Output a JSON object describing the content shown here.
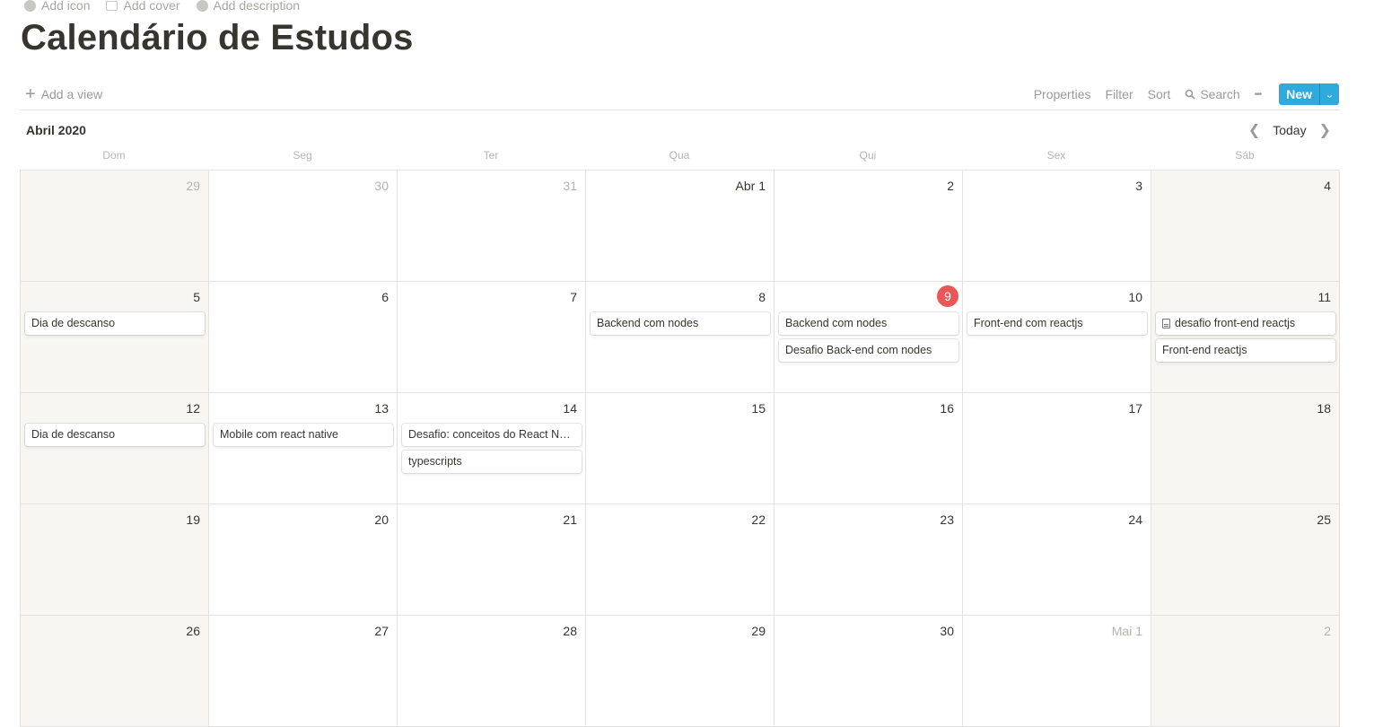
{
  "page_meta": {
    "add_icon": "Add icon",
    "add_cover": "Add cover",
    "add_description": "Add description"
  },
  "title": "Calendário de Estudos",
  "toolbar": {
    "add_view": "Add a view",
    "properties": "Properties",
    "filter": "Filter",
    "sort": "Sort",
    "search": "Search",
    "more": "•••",
    "new": "New"
  },
  "calendar": {
    "month": "Abril 2020",
    "today": "Today",
    "weekdays": [
      "Dom",
      "Seg",
      "Ter",
      "Qua",
      "Qui",
      "Sex",
      "Sáb"
    ],
    "weeks": [
      [
        {
          "d": "29",
          "muted": true
        },
        {
          "d": "30",
          "muted": true
        },
        {
          "d": "31",
          "muted": true
        },
        {
          "d": "Abr 1"
        },
        {
          "d": "2"
        },
        {
          "d": "3"
        },
        {
          "d": "4"
        }
      ],
      [
        {
          "d": "5",
          "events": [
            {
              "t": "Dia de descanso"
            }
          ]
        },
        {
          "d": "6"
        },
        {
          "d": "7"
        },
        {
          "d": "8",
          "events": [
            {
              "t": "Backend com nodes"
            }
          ]
        },
        {
          "d": "9",
          "today": true,
          "events": [
            {
              "t": "Backend com nodes"
            },
            {
              "t": "Desafio Back-end com nodes"
            }
          ]
        },
        {
          "d": "10",
          "events": [
            {
              "t": "Front-end com reactjs"
            }
          ]
        },
        {
          "d": "11",
          "events": [
            {
              "t": "desafio front-end reactjs",
              "icon": "document-icon"
            },
            {
              "t": "Front-end reactjs"
            }
          ]
        }
      ],
      [
        {
          "d": "12",
          "events": [
            {
              "t": "Dia de descanso"
            }
          ]
        },
        {
          "d": "13",
          "events": [
            {
              "t": "Mobile com react native"
            }
          ]
        },
        {
          "d": "14",
          "events": [
            {
              "t": "Desafio: conceitos do React Native"
            },
            {
              "t": "typescripts"
            }
          ]
        },
        {
          "d": "15"
        },
        {
          "d": "16"
        },
        {
          "d": "17"
        },
        {
          "d": "18"
        }
      ],
      [
        {
          "d": "19"
        },
        {
          "d": "20"
        },
        {
          "d": "21"
        },
        {
          "d": "22"
        },
        {
          "d": "23"
        },
        {
          "d": "24"
        },
        {
          "d": "25"
        }
      ],
      [
        {
          "d": "26"
        },
        {
          "d": "27"
        },
        {
          "d": "28"
        },
        {
          "d": "29"
        },
        {
          "d": "30"
        },
        {
          "d": "Mai 1",
          "muted": true
        },
        {
          "d": "2",
          "muted": true
        }
      ]
    ]
  }
}
